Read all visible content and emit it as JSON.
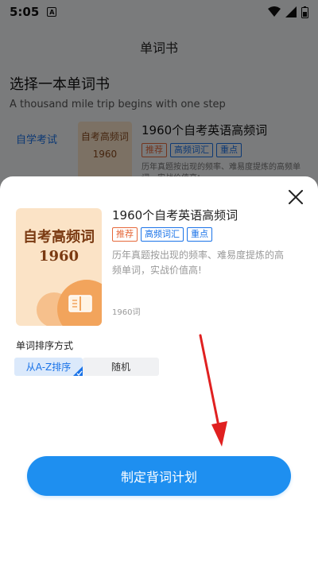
{
  "status_bar": {
    "time": "5:05",
    "notification_icon": "A"
  },
  "background_page": {
    "header_title": "单词书",
    "section_title": "选择一本单词书",
    "section_subtitle": "A thousand mile trip begins with one step",
    "category": "自学考试",
    "cover_lines": [
      "自考高频词",
      "1960"
    ],
    "book_title": "1960个自考英语高频词",
    "tags": [
      "推荐",
      "高频词汇",
      "重点"
    ],
    "description": "历年真题按出现的频率、难易度提炼的高频单词，实战价值高!"
  },
  "sheet": {
    "cover": {
      "title": "自考高频词",
      "year": "1960"
    },
    "book_title": "1960个自考英语高频词",
    "tags": [
      {
        "label": "推荐",
        "style": "red"
      },
      {
        "label": "高频词汇",
        "style": "blue"
      },
      {
        "label": "重点",
        "style": "blue"
      }
    ],
    "description": "历年真题按出现的频率、难易度提炼的高频单词，实战价值高!",
    "word_count": "1960词",
    "sort_label": "单词排序方式",
    "sort_options": [
      {
        "label": "从A-Z排序",
        "selected": true
      },
      {
        "label": "随机",
        "selected": false
      }
    ],
    "plan_button": "制定背词计划"
  },
  "colors": {
    "accent": "#1e8ff0",
    "tag_red": "#e5683a",
    "tag_blue": "#1a73e8",
    "arrow": "#e02020",
    "cover_bg": "#fbe3c6"
  },
  "icons": [
    "close-icon",
    "book-icon",
    "check-icon",
    "wifi-icon",
    "signal-icon",
    "battery-icon"
  ]
}
